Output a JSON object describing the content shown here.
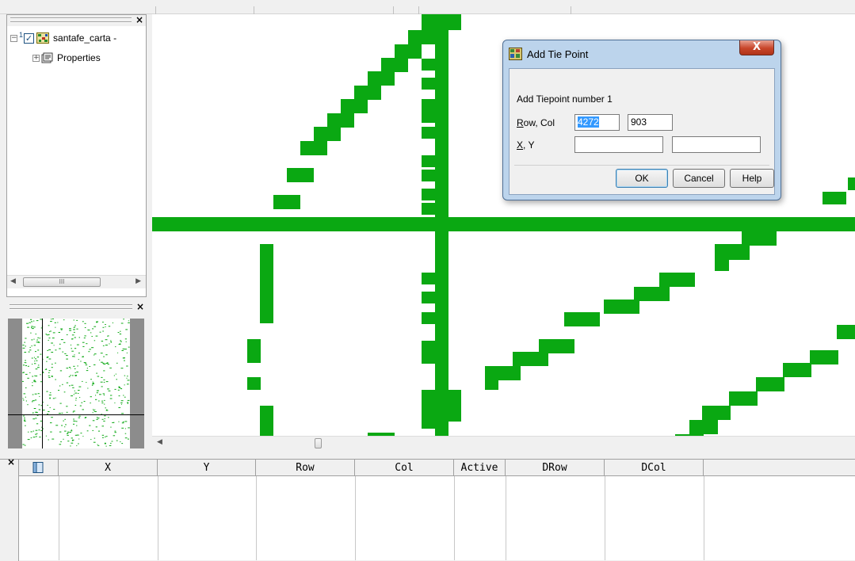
{
  "layer_tree": {
    "layer_number": "1",
    "layer_name": "santafe_carta -",
    "layer_checked": "✓",
    "properties_label": "Properties",
    "layer_expander": "−",
    "properties_expander": "+"
  },
  "close_glyph": "×",
  "scroll_left_glyph": "◀",
  "scroll_right_glyph": "▶",
  "scroll_thumb_grip": "III",
  "dialog": {
    "title": "Add Tie Point",
    "close_glyph": "X",
    "instruction": "Add Tiepoint number 1",
    "row_col_label_key": "R",
    "row_col_label_rest": "ow, Col",
    "xy_label_key": "X",
    "xy_label_rest": ", Y",
    "row_value": "4272",
    "col_value": "903",
    "x_value": "",
    "y_value": "",
    "ok_label": "OK",
    "cancel_label": "Cancel",
    "help_label": "Help"
  },
  "table": {
    "columns": [
      "X",
      "Y",
      "Row",
      "Col",
      "Active",
      "DRow",
      "DCol"
    ]
  },
  "colors": {
    "map_lines": "#0aa812",
    "background": "#f0f0f0",
    "dialog_frame": "#bcd4ec"
  }
}
